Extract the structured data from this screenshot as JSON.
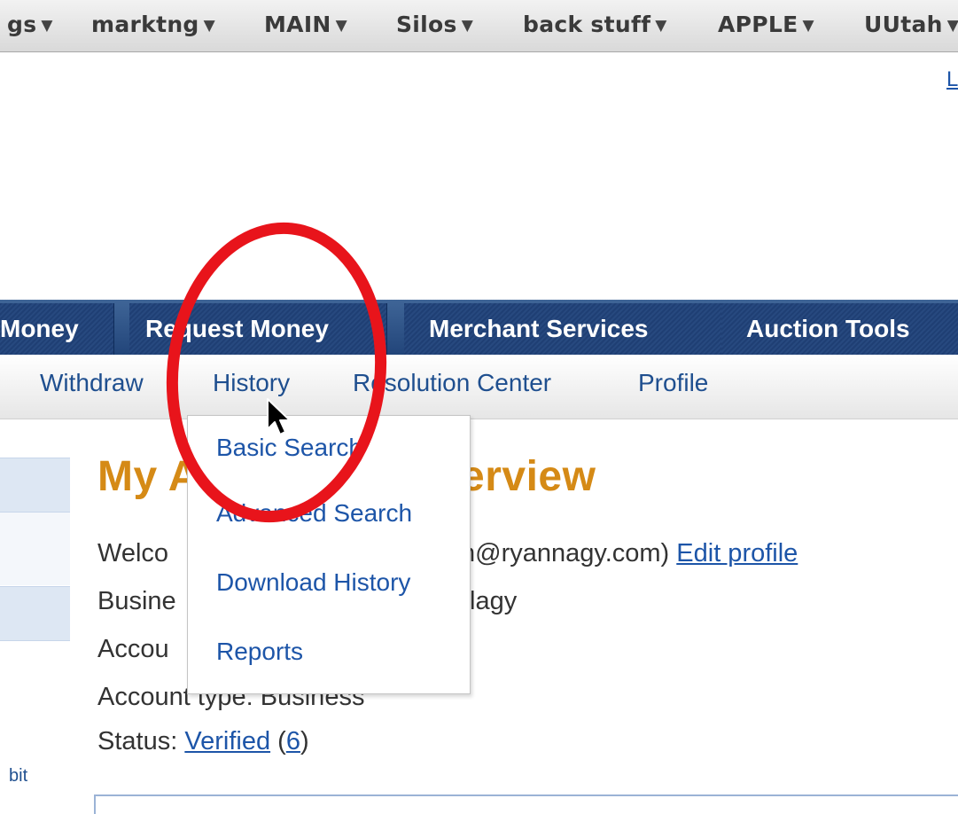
{
  "bookmarks_bar": {
    "items": [
      {
        "label": "gs",
        "arrow": "▼"
      },
      {
        "label": "marktng",
        "arrow": "▼"
      },
      {
        "label": "MAIN",
        "arrow": "▼"
      },
      {
        "label": "Silos",
        "arrow": "▼"
      },
      {
        "label": "back stuff",
        "arrow": "▼"
      },
      {
        "label": "APPLE",
        "arrow": "▼"
      },
      {
        "label": "UUtah",
        "arrow": "▼"
      }
    ]
  },
  "top_right_link": "L",
  "tabs": [
    "Money",
    "Request Money",
    "Merchant Services",
    "Auction Tools"
  ],
  "subnav": [
    "Withdraw",
    "History",
    "Resolution Center",
    "Profile"
  ],
  "dropdown": {
    "items": [
      "Basic Search",
      "Advanced Search",
      "Download History",
      "Reports"
    ]
  },
  "main": {
    "title_left": "My A",
    "title_right": "erview",
    "welcome_prefix": "Welco",
    "welcome_suffix": "n@ryannagy.com)",
    "edit_profile": "Edit profile",
    "business_prefix": "Busine",
    "business_suffix": "lagy",
    "account_prefix": "Accou",
    "account_type": "Account type: Business",
    "status_label": "Status:",
    "status_value": "Verified",
    "status_open": "(",
    "status_count": "6",
    "status_close": ")"
  },
  "sidebar": {
    "bottom_text": "bit"
  },
  "colors": {
    "tab_bar": "#22457a",
    "link": "#1d55a8",
    "title": "#d58a16",
    "annotation": "#e8141b"
  }
}
